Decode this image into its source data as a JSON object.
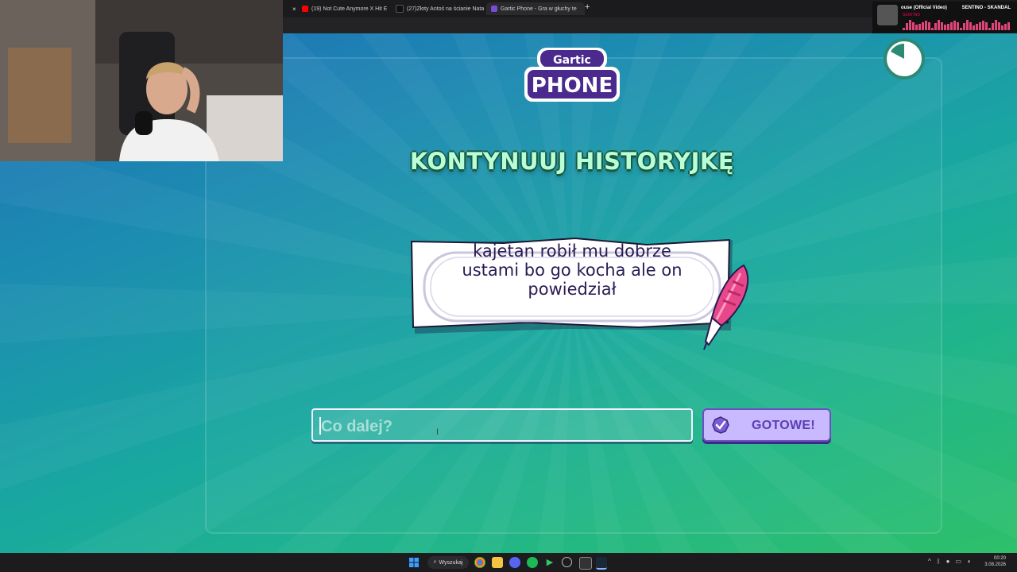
{
  "browser": {
    "tabs": [
      {
        "title": "(19) Not Cute Anymore X Hit E",
        "color": "#ff0000",
        "close": "×"
      },
      {
        "title": "(27)Złoty Antoś na ścianie Nata",
        "color": "#111111",
        "close": "×"
      },
      {
        "title": "Gartic Phone - Gra w głuchy te",
        "color": "#7a4bd6",
        "close": "×"
      }
    ],
    "first_close": "×",
    "new_tab": "+"
  },
  "now_playing": {
    "title": "ouse (Official Video)",
    "artist_header": "SENTINO - SKANDAL",
    "artist": "SENTINO"
  },
  "game": {
    "heading": "KONTYNUUJ HISTORYJKĘ",
    "story": "kajetan robił mu dobrze ustami bo go kocha ale on powiedział",
    "input_placeholder": "Co dalej?",
    "done_label": "GOTOWE!",
    "logo_top": "Gartic",
    "logo_bottom": "PHONE",
    "accent_purple": "#5b3fb0",
    "heading_color": "#b8ffd9"
  },
  "taskbar": {
    "search_label": "Wyszukaj",
    "time": "00:20",
    "date": "3.08.2026",
    "icons": [
      "windows-start-icon",
      "chrome-icon",
      "file-explorer-icon",
      "discord-icon",
      "spotify-icon",
      "play-icon",
      "settings-icon",
      "epic-games-icon",
      "steam-icon"
    ]
  }
}
